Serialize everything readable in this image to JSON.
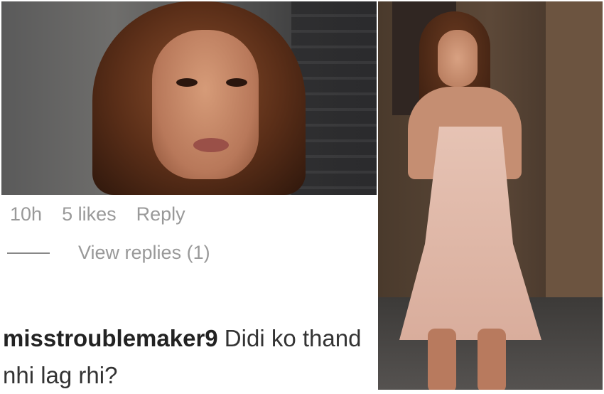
{
  "comment_meta": {
    "time": "10h",
    "likes": "5 likes",
    "reply_label": "Reply"
  },
  "replies": {
    "view_label": "View replies (1)"
  },
  "comment": {
    "username": "misstroublemaker9",
    "text_line1": " Didi ko thand",
    "text_line2": "nhi lag rhi?"
  },
  "images": {
    "left_photo": "portrait-closeup",
    "right_photo": "full-length-photo-pink-dress"
  }
}
